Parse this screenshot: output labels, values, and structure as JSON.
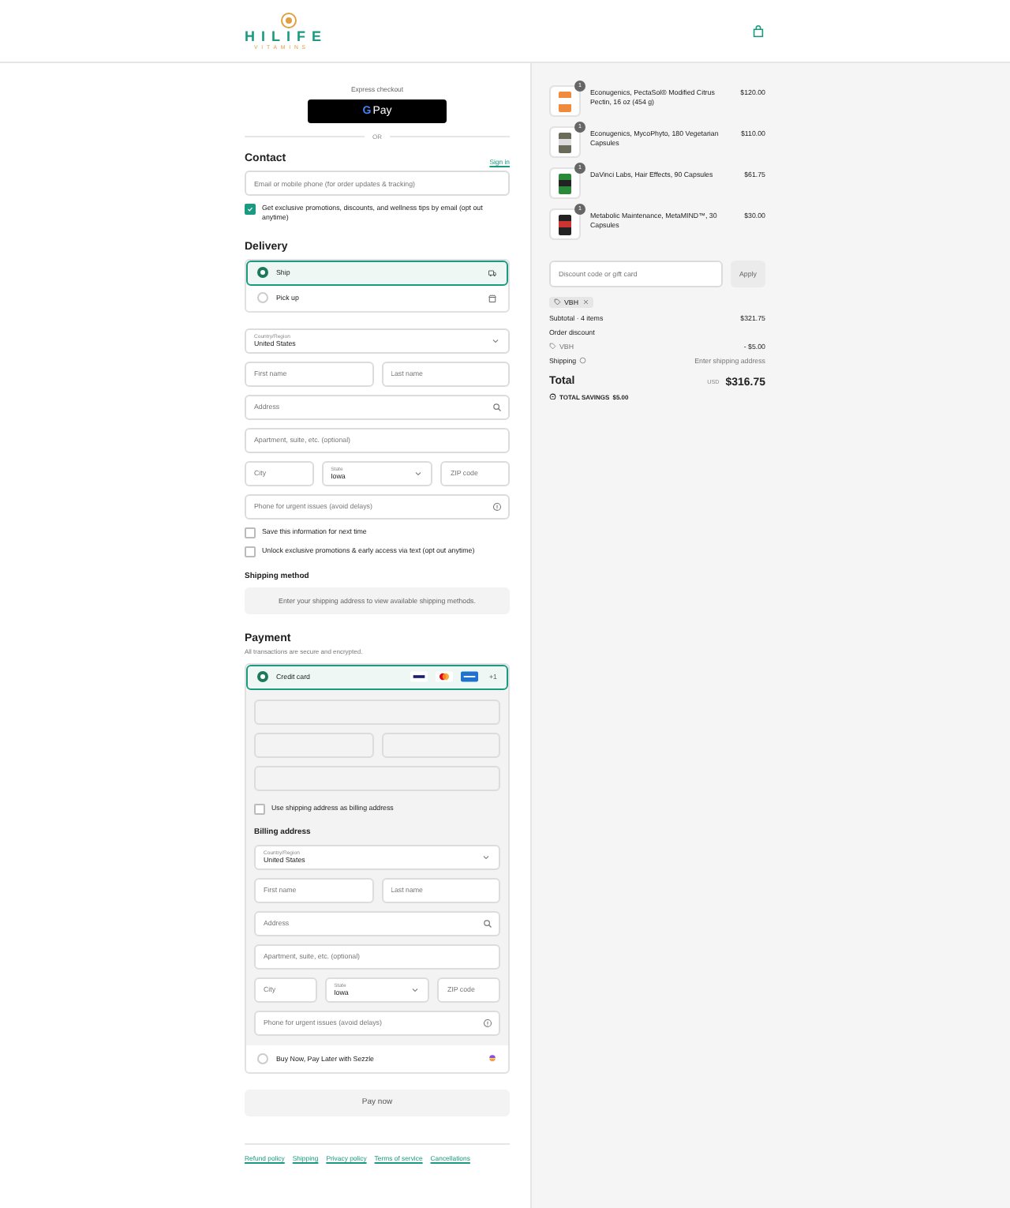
{
  "header": {
    "logo_text": "HILIFE",
    "logo_tagline": "VITAMINS"
  },
  "express": {
    "title": "Express checkout",
    "gpay_mark": "G",
    "gpay_label": "Pay",
    "divider": "OR"
  },
  "contact": {
    "title": "Contact",
    "sign_in": "Sign in",
    "email_placeholder": "Email or mobile phone (for order updates & tracking)",
    "marketing": {
      "label": "Get exclusive promotions, discounts, and wellness tips by email (opt out anytime)",
      "checked": true
    }
  },
  "delivery": {
    "title": "Delivery",
    "options": [
      {
        "label": "Ship",
        "selected": true,
        "kind": "ship"
      },
      {
        "label": "Pick up",
        "selected": false,
        "kind": "pickup"
      }
    ],
    "rows": [
      [
        {
          "kind": "select",
          "label": "Country/Region",
          "value": "United States"
        }
      ],
      [
        {
          "kind": "text",
          "placeholder": "First name"
        },
        {
          "kind": "text",
          "placeholder": "Last name"
        }
      ],
      [
        {
          "kind": "search",
          "placeholder": "Address"
        }
      ],
      [
        {
          "kind": "text",
          "placeholder": "Apartment, suite, etc. (optional)"
        }
      ],
      [
        {
          "kind": "text",
          "placeholder": "City"
        },
        {
          "kind": "select",
          "label": "State",
          "value": "Iowa"
        },
        {
          "kind": "text",
          "placeholder": "ZIP code"
        }
      ],
      [
        {
          "kind": "help",
          "placeholder": "Phone for urgent issues (avoid delays)"
        }
      ]
    ],
    "checkboxes": [
      {
        "label": "Save this information for next time",
        "checked": false
      },
      {
        "label": "Unlock exclusive promotions & early access via text (opt out anytime)",
        "checked": false
      }
    ]
  },
  "shipping_method": {
    "title": "Shipping method",
    "message": "Enter your shipping address to view available shipping methods."
  },
  "payment": {
    "title": "Payment",
    "note": "All transactions are secure and encrypted.",
    "card": {
      "label": "Credit card",
      "selected": true,
      "more": "+1"
    },
    "billing_checkbox": {
      "label": "Use shipping address as billing address",
      "checked": false
    },
    "billing": {
      "title": "Billing address",
      "rows": [
        [
          {
            "kind": "select",
            "label": "Country/Region",
            "value": "United States"
          }
        ],
        [
          {
            "kind": "text",
            "placeholder": "First name"
          },
          {
            "kind": "text",
            "placeholder": "Last name"
          }
        ],
        [
          {
            "kind": "search",
            "placeholder": "Address"
          }
        ],
        [
          {
            "kind": "text",
            "placeholder": "Apartment, suite, etc. (optional)"
          }
        ],
        [
          {
            "kind": "text",
            "placeholder": "City"
          },
          {
            "kind": "select",
            "label": "State",
            "value": "Iowa"
          },
          {
            "kind": "text",
            "placeholder": "ZIP code"
          }
        ],
        [
          {
            "kind": "help",
            "placeholder": "Phone for urgent issues (avoid delays)"
          }
        ]
      ]
    },
    "sezzle": {
      "label": "Buy Now, Pay Later with Sezzle",
      "selected": false
    }
  },
  "pay_button": "Pay now",
  "footer_links": [
    "Refund policy",
    "Shipping",
    "Privacy policy",
    "Terms of service",
    "Cancellations"
  ],
  "summary": {
    "items": [
      {
        "name": "Econugenics, PectaSol® Modified Citrus Pectin, 16 oz (454 g)",
        "price": "$120.00",
        "quantity": "1"
      },
      {
        "name": "Econugenics, MycoPhyto, 180 Vegetarian Capsules",
        "price": "$110.00",
        "quantity": "1"
      },
      {
        "name": "DaVinci Labs, Hair Effects, 90 Capsules",
        "price": "$61.75",
        "quantity": "1"
      },
      {
        "name": "Metabolic Maintenance, MetaMIND™, 30 Capsules",
        "price": "$30.00",
        "quantity": "1"
      }
    ],
    "discount_placeholder": "Discount code or gift card",
    "apply": "Apply",
    "code_tag": "VBH",
    "subtotal_label": "Subtotal · 4 items",
    "subtotal": "$321.75",
    "order_discount": "Order discount",
    "discount_code": "VBH",
    "discount_amount": "- $5.00",
    "shipping_label": "Shipping",
    "shipping_value": "Enter shipping address",
    "total_label": "Total",
    "currency": "USD",
    "total": "$316.75",
    "savings_label": "TOTAL SAVINGS",
    "savings": "$5.00"
  }
}
